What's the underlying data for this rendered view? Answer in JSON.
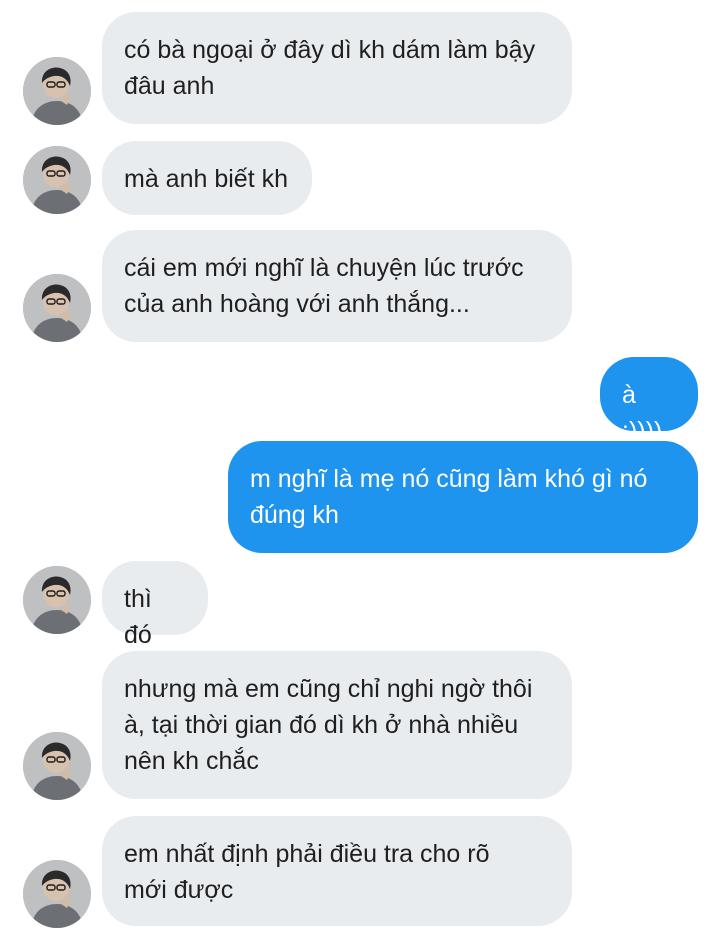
{
  "conversation": {
    "messages": [
      {
        "side": "in",
        "text": "có bà ngoại ở đây dì kh dám làm bậy\nđâu anh"
      },
      {
        "side": "in",
        "text": "mà anh biết kh"
      },
      {
        "side": "in",
        "text": "cái em mới nghĩ là chuyện lúc trước\ncủa anh hoàng với anh thắng..."
      },
      {
        "side": "out",
        "text": "à :))))"
      },
      {
        "side": "out",
        "text": "m nghĩ là mẹ nó cũng làm khó gì nó\nđúng kh"
      },
      {
        "side": "in",
        "text": "thì đó"
      },
      {
        "side": "in",
        "text": "nhưng mà em cũng chỉ nghi ngờ thôi\nà, tại thời gian đó dì kh ở nhà nhiều\nnên kh chắc"
      },
      {
        "side": "in",
        "text": "em nhất định phải điều tra cho rõ\nmới được"
      }
    ]
  },
  "colors": {
    "incoming_bubble": "#e9ecef",
    "outgoing_bubble": "#1f94ee",
    "incoming_text": "#1f1f1f",
    "outgoing_text": "#ffffff"
  }
}
